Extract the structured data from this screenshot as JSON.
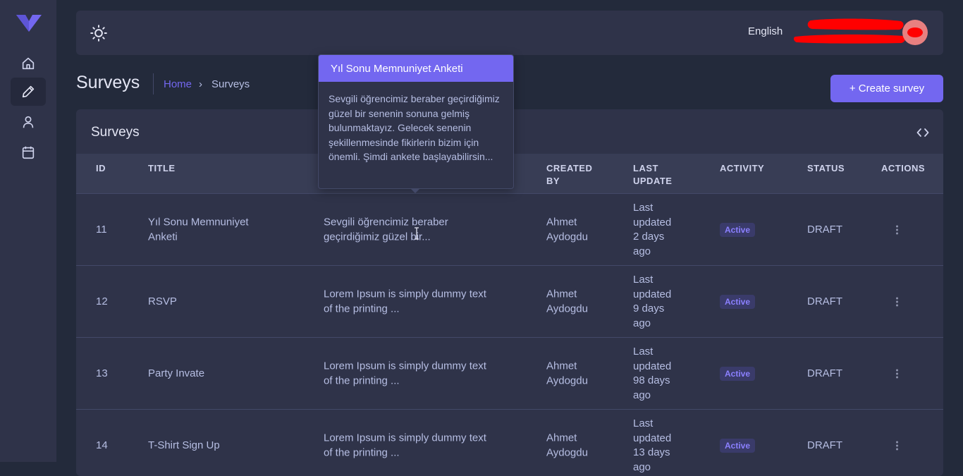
{
  "topbar": {
    "language": "English"
  },
  "page": {
    "title": "Surveys",
    "breadcrumb_home": "Home",
    "breadcrumb_separator": "›",
    "breadcrumb_current": "Surveys",
    "create_button": "+ Create survey"
  },
  "card": {
    "title": "Surveys"
  },
  "table": {
    "headers": {
      "id": "ID",
      "title": "TITLE",
      "created_by_1": "CREATED",
      "created_by_2": "BY",
      "last_update_1": "LAST",
      "last_update_2": "UPDATE",
      "activity": "ACTIVITY",
      "status": "STATUS",
      "actions": "ACTIONS"
    },
    "rows": [
      {
        "id": "11",
        "title_1": "Yıl Sonu Memnuniyet",
        "title_2": "Anketi",
        "desc_1": "Sevgili öğrencimiz beraber",
        "desc_2": "geçirdiğimiz güzel bir...",
        "created_1": "Ahmet",
        "created_2": "Aydogdu",
        "upd_1": "Last",
        "upd_2": "updated",
        "upd_3": "2 days",
        "upd_4": "ago",
        "activity": "Active",
        "status": "DRAFT"
      },
      {
        "id": "12",
        "title_1": "RSVP",
        "title_2": "",
        "desc_1": "Lorem Ipsum is simply dummy text",
        "desc_2": "of the printing ...",
        "created_1": "Ahmet",
        "created_2": "Aydogdu",
        "upd_1": "Last",
        "upd_2": "updated",
        "upd_3": "9 days",
        "upd_4": "ago",
        "activity": "Active",
        "status": "DRAFT"
      },
      {
        "id": "13",
        "title_1": "Party Invate",
        "title_2": "",
        "desc_1": "Lorem Ipsum is simply dummy text",
        "desc_2": "of the printing ...",
        "created_1": "Ahmet",
        "created_2": "Aydogdu",
        "upd_1": "Last",
        "upd_2": "updated",
        "upd_3": "98 days",
        "upd_4": "ago",
        "activity": "Active",
        "status": "DRAFT"
      },
      {
        "id": "14",
        "title_1": "T-Shirt Sign Up",
        "title_2": "",
        "desc_1": "Lorem Ipsum is simply dummy text",
        "desc_2": "of the printing ...",
        "created_1": "Ahmet",
        "created_2": "Aydogdu",
        "upd_1": "Last",
        "upd_2": "updated",
        "upd_3": "13 days",
        "upd_4": "ago",
        "activity": "Active",
        "status": "DRAFT"
      }
    ]
  },
  "popover": {
    "title": "Yıl Sonu Memnuniyet Anketi",
    "body": "Sevgili öğrencimiz beraber geçirdiğimiz güzel bir senenin sonuna gelmiş bulunmaktayız. Gelecek senenin şekillenmesinde fikirlerin bizim için önemli. Şimdi ankete başlayabilirsin..."
  },
  "icons": {
    "brand": "logo-icon",
    "nav": [
      "home-icon",
      "pencil-icon",
      "user-icon",
      "calendar-icon"
    ],
    "theme": "sun-icon",
    "card_action": "code-icon",
    "row_action": "more-vertical-icon"
  },
  "colors": {
    "accent": "#7367f0",
    "background": "#232a3b",
    "surface": "#2f3349",
    "badge_text": "#8b80ff"
  }
}
